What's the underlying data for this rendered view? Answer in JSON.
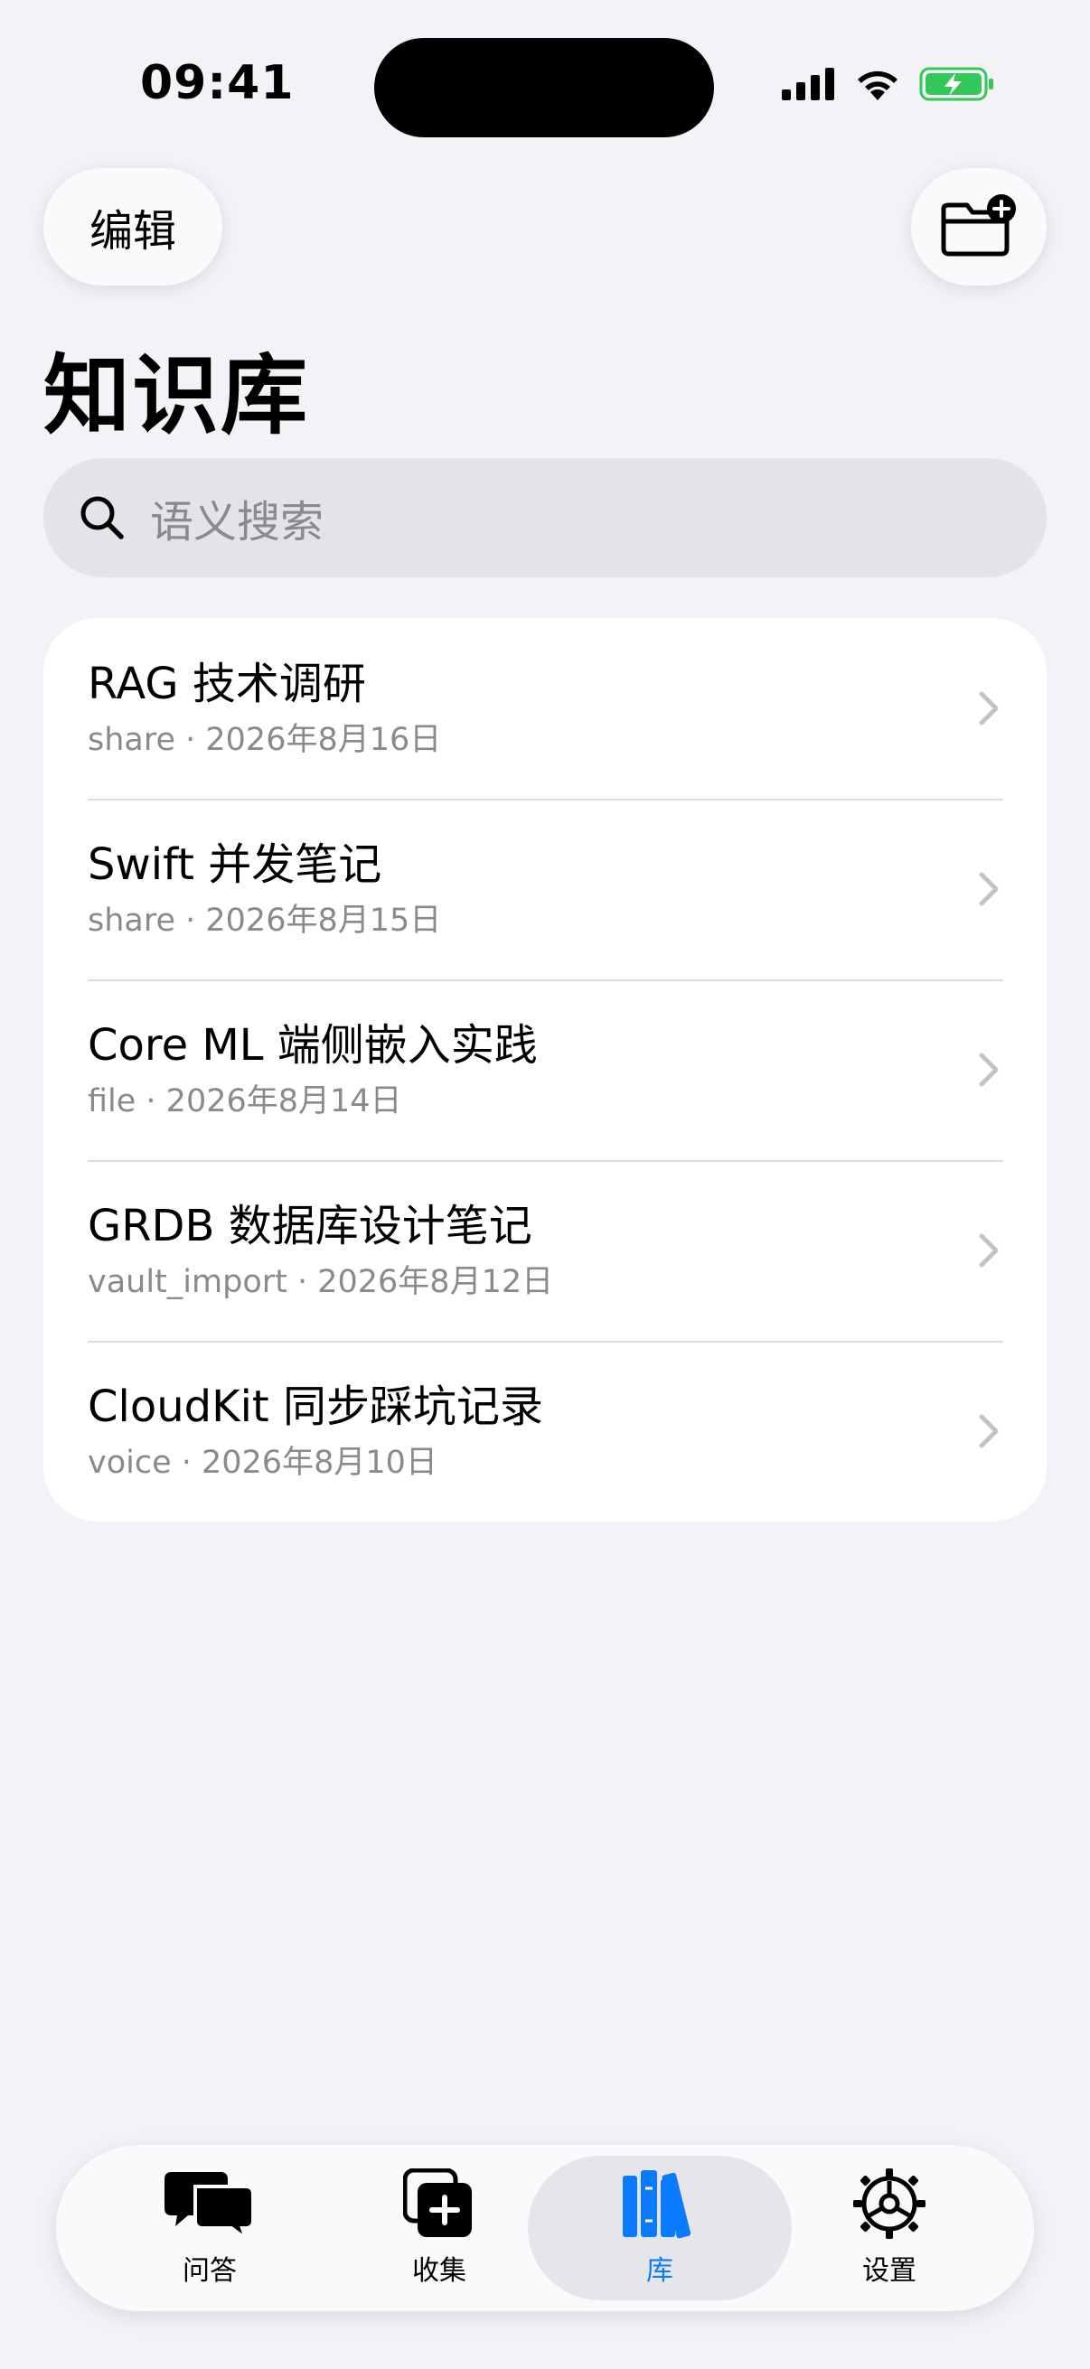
{
  "status_bar": {
    "time": "09:41"
  },
  "header": {
    "edit_label": "编辑",
    "title": "知识库"
  },
  "search": {
    "placeholder": "语义搜索"
  },
  "items": [
    {
      "title": "RAG 技术调研",
      "subtitle": "share · 2026年8月16日"
    },
    {
      "title": "Swift 并发笔记",
      "subtitle": "share · 2026年8月15日"
    },
    {
      "title": "Core ML 端侧嵌入实践",
      "subtitle": "file · 2026年8月14日"
    },
    {
      "title": "GRDB 数据库设计笔记",
      "subtitle": "vault_import · 2026年8月12日"
    },
    {
      "title": "CloudKit 同步踩坑记录",
      "subtitle": "voice · 2026年8月10日"
    }
  ],
  "tabs": [
    {
      "label": "问答",
      "icon": "chat-bubbles-icon"
    },
    {
      "label": "收集",
      "icon": "add-square-icon"
    },
    {
      "label": "库",
      "icon": "books-icon",
      "active": true
    },
    {
      "label": "设置",
      "icon": "gear-icon"
    }
  ],
  "colors": {
    "accent": "#0a7aff",
    "background": "#f2f2f7",
    "battery": "#34c759"
  }
}
